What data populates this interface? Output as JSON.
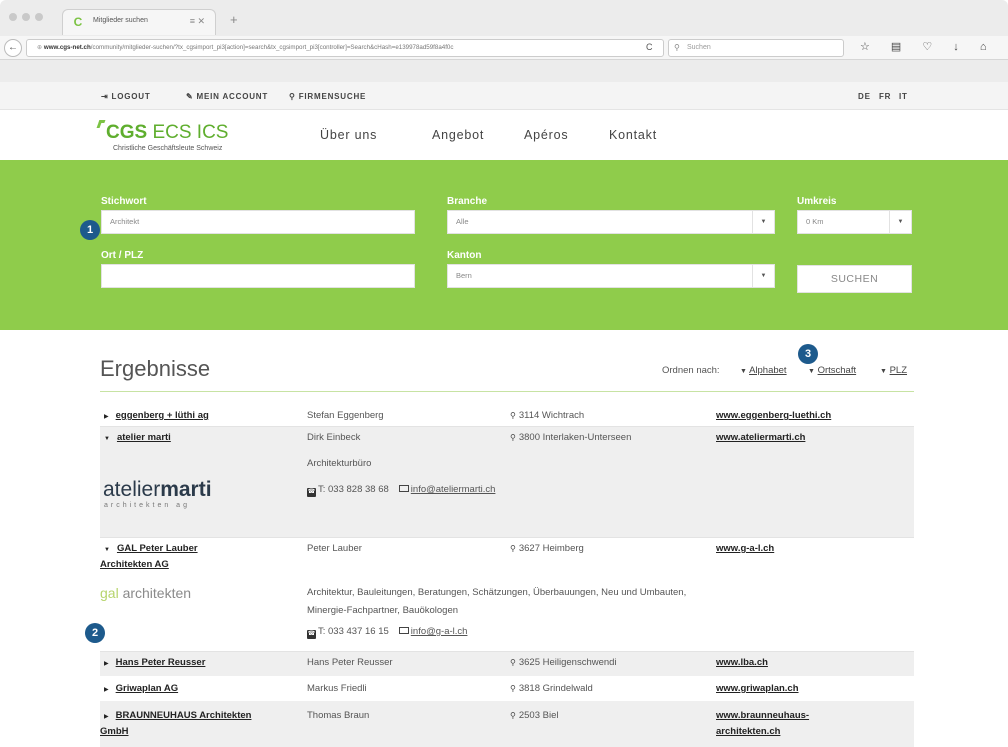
{
  "browser": {
    "tab_title": "Mitglieder suchen",
    "tab_favicon": "C",
    "tab_close": "≡ ✕",
    "new_tab": "+",
    "back": "←",
    "url_domain": "www.cgs-net.ch",
    "url_path": "/community/mitglieder-suchen/?tx_cgsimport_pi3[action]=search&tx_cgsimport_pi3[controller]=Search&cHash=e139978ad59f8a4f0c",
    "reload": "C",
    "search_placeholder": "Suchen",
    "toolbar_icons": "☆ ▤ ♡ ↓ ⌂ ☻ ≡"
  },
  "topbar": {
    "logout": "LOGOUT",
    "account": "MEIN ACCOUNT",
    "firmensuche": "FIRMENSUCHE",
    "logout_icon": "⇥",
    "account_icon": "✎",
    "search_icon": "⚲",
    "lang_de": "DE",
    "lang_fr": "FR",
    "lang_it": "IT"
  },
  "brand": {
    "logo_bold": "CGS",
    "logo_rest": " ECS ICS",
    "tagline": "Christliche Geschäftsleute Schweiz"
  },
  "nav": [
    "Über uns",
    "Angebot",
    "Apéros",
    "Kontakt"
  ],
  "search": {
    "stichwort_label": "Stichwort",
    "stichwort_value": "Architekt",
    "branche_label": "Branche",
    "branche_value": "Alle",
    "umkreis_label": "Umkreis",
    "umkreis_value": "0 Km",
    "ort_label": "Ort / PLZ",
    "ort_value": "",
    "kanton_label": "Kanton",
    "kanton_value": "Bern",
    "submit": "SUCHEN",
    "arrow": "▼"
  },
  "badges": [
    "1",
    "2",
    "3"
  ],
  "results": {
    "title": "Ergebnisse",
    "sort_label": "Ordnen nach:",
    "sort_tri": "▼",
    "sort_alpha": "Alphabet",
    "sort_ort": "Ortschaft",
    "sort_plz": "PLZ",
    "tri_closed": "▶",
    "tri_open": "▼",
    "pin": "⚲",
    "rows": [
      {
        "name": "eggenberg + lüthi ag",
        "person": "Stefan Eggenberg",
        "place": "3114 Wichtrach",
        "web": "www.eggenberg-luethi.ch"
      },
      {
        "name": "atelier marti",
        "person": "Dirk Einbeck",
        "place": "3800 Interlaken-Unterseen",
        "web": "www.ateliermarti.ch",
        "category": "Architekturbüro",
        "phone": "T: 033 828 38 68",
        "email": "info@ateliermarti.ch",
        "logo": "ateliermarti",
        "logo_light": "atelier",
        "logo_bold": "marti",
        "logo_sub": "architekten ag"
      },
      {
        "name_line1": "GAL Peter Lauber",
        "name_line2": "Architekten AG",
        "person": "Peter Lauber",
        "place": "3627 Heimberg",
        "web": "www.g-a-l.ch",
        "description": "Architektur, Bauleitungen, Beratungen, Schätzungen, Überbauungen, Neu und Umbauten, Minergie-Fachpartner, Bauökologen",
        "phone": "T: 033 437 16 15",
        "email": "info@g-a-l.ch",
        "logo_g": "gal",
        "logo_rest": " architekten"
      },
      {
        "name": "Hans Peter Reusser",
        "person": "Hans Peter Reusser",
        "place": "3625 Heiligenschwendi",
        "web": "www.lba.ch"
      },
      {
        "name": "Griwaplan AG",
        "person": "Markus Friedli",
        "place": "3818 Grindelwald",
        "web": "www.griwaplan.ch"
      },
      {
        "name_line1": "BRAUNNEUHAUS Architekten",
        "name_line2": "GmbH",
        "person": "Thomas Braun",
        "place": "2503 Biel",
        "web_line1": "www.braunneuhaus-",
        "web_line2": "architekten.ch"
      }
    ]
  },
  "colors": {
    "green_panel": "#8fcc4b",
    "badge_blue": "#1d5a8c",
    "logo_green": "#5fae2e"
  }
}
